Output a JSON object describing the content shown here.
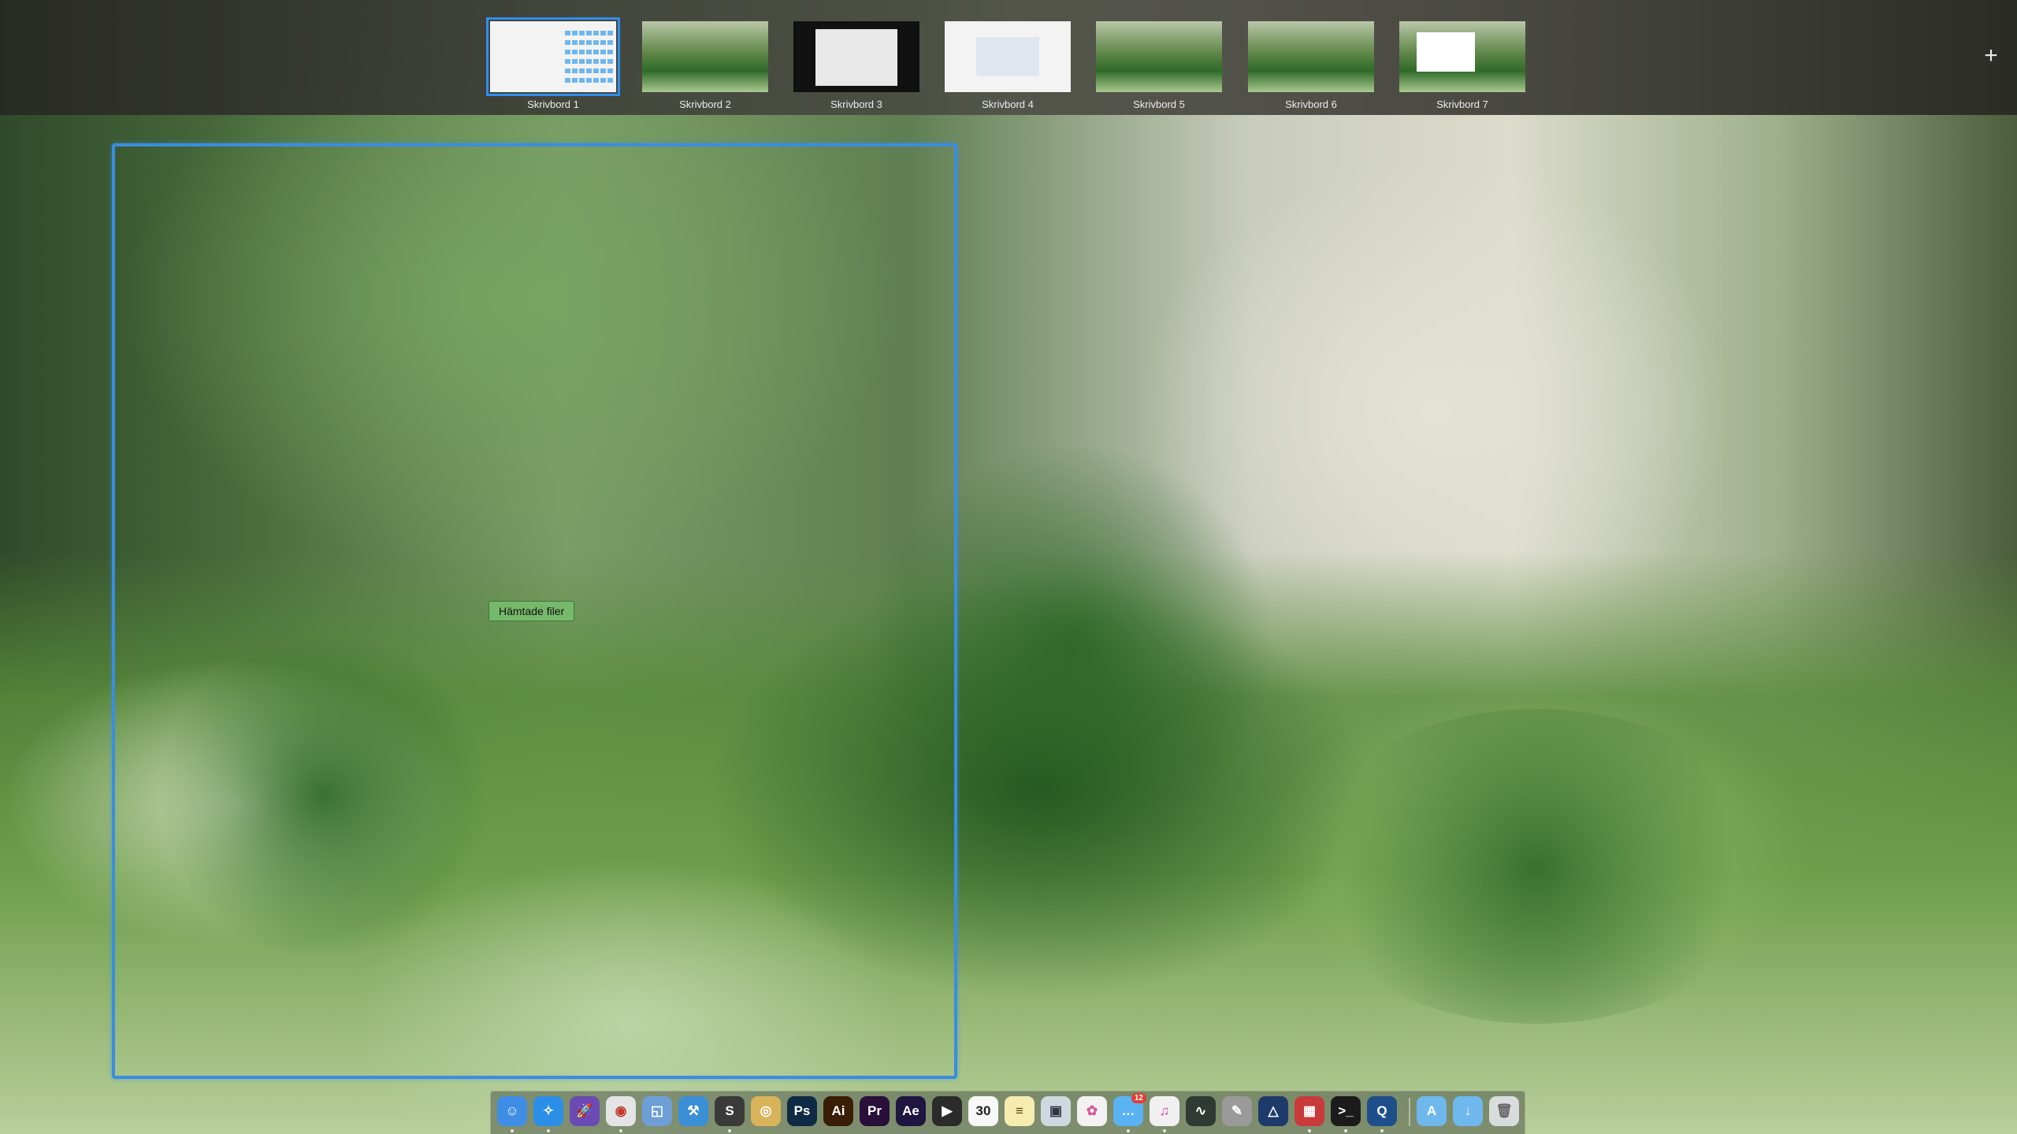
{
  "spaces": [
    {
      "label": "Skrivbord 1",
      "active": true
    },
    {
      "label": "Skrivbord 2",
      "active": false
    },
    {
      "label": "Skrivbord 3",
      "active": false
    },
    {
      "label": "Skrivbord 4",
      "active": false
    },
    {
      "label": "Skrivbord 5",
      "active": false
    },
    {
      "label": "Skrivbord 6",
      "active": false
    },
    {
      "label": "Skrivbord 7",
      "active": false
    }
  ],
  "add_space": {
    "icon": "plus-icon",
    "label": "+"
  },
  "window": {
    "title": "Hämtade filer"
  },
  "dock": {
    "apps": [
      {
        "name": "finder",
        "glyph": "☺",
        "running": true
      },
      {
        "name": "safari",
        "glyph": "✧",
        "running": true
      },
      {
        "name": "launchpad",
        "glyph": "🚀",
        "running": false
      },
      {
        "name": "chrome",
        "glyph": "◉",
        "running": true
      },
      {
        "name": "preview",
        "glyph": "◱",
        "running": false
      },
      {
        "name": "xcode",
        "glyph": "⚒",
        "running": false
      },
      {
        "name": "sublime-text",
        "glyph": "S",
        "running": true
      },
      {
        "name": "sequel-pro",
        "glyph": "◎",
        "running": false
      },
      {
        "name": "photoshop",
        "glyph": "Ps",
        "running": false
      },
      {
        "name": "illustrator",
        "glyph": "Ai",
        "running": false
      },
      {
        "name": "premiere",
        "glyph": "Pr",
        "running": false
      },
      {
        "name": "after-effects",
        "glyph": "Ae",
        "running": false
      },
      {
        "name": "final-cut-pro",
        "glyph": "▶",
        "running": false
      },
      {
        "name": "calendar",
        "glyph": "30",
        "running": false
      },
      {
        "name": "notes",
        "glyph": "≡",
        "running": false
      },
      {
        "name": "preview-2",
        "glyph": "▣",
        "running": false
      },
      {
        "name": "photos",
        "glyph": "✿",
        "running": false
      },
      {
        "name": "messages",
        "glyph": "…",
        "running": true,
        "badge": "12"
      },
      {
        "name": "itunes",
        "glyph": "♫",
        "running": true
      },
      {
        "name": "activity-monitor",
        "glyph": "∿",
        "running": false
      },
      {
        "name": "script-editor",
        "glyph": "✎",
        "running": false
      },
      {
        "name": "instruments",
        "glyph": "△",
        "running": false
      },
      {
        "name": "parallels",
        "glyph": "▦",
        "running": true
      },
      {
        "name": "terminal",
        "glyph": ">_",
        "running": true
      },
      {
        "name": "quicktime",
        "glyph": "Q",
        "running": true
      }
    ],
    "stacks": [
      {
        "name": "applications-folder",
        "glyph": "A"
      },
      {
        "name": "downloads-folder",
        "glyph": "↓"
      },
      {
        "name": "trash",
        "glyph": "🗑"
      }
    ]
  },
  "colors": {
    "accent": "#3a8de0",
    "space_bar": "#3a3a35",
    "label_text": "#ececec"
  }
}
